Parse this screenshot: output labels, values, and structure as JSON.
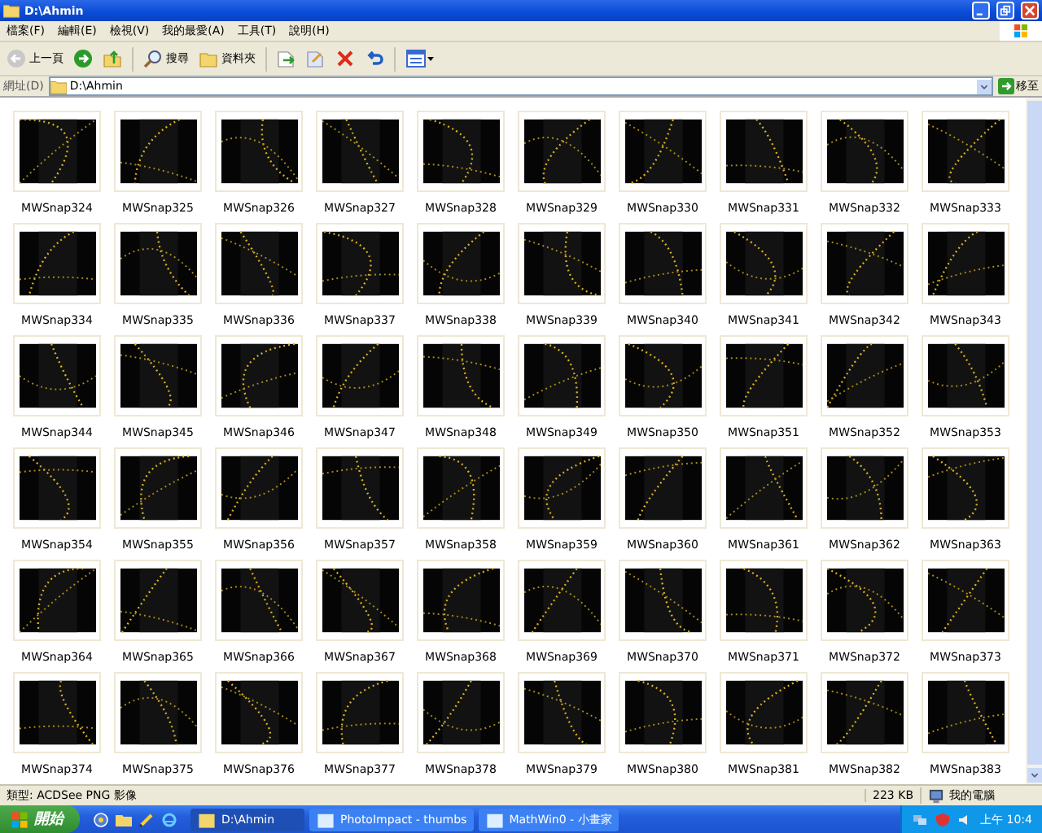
{
  "window": {
    "title": "D:\\Ahmin"
  },
  "menu": [
    "檔案(F)",
    "編輯(E)",
    "檢視(V)",
    "我的最愛(A)",
    "工具(T)",
    "說明(H)"
  ],
  "toolbar": {
    "back": "上一頁",
    "search": "搜尋",
    "folders": "資料夾"
  },
  "address": {
    "label": "網址(D)",
    "value": "D:\\Ahmin",
    "go": "移至"
  },
  "files": [
    "MWSnap324",
    "MWSnap325",
    "MWSnap326",
    "MWSnap327",
    "MWSnap328",
    "MWSnap329",
    "MWSnap330",
    "MWSnap331",
    "MWSnap332",
    "MWSnap333",
    "MWSnap334",
    "MWSnap335",
    "MWSnap336",
    "MWSnap337",
    "MWSnap338",
    "MWSnap339",
    "MWSnap340",
    "MWSnap341",
    "MWSnap342",
    "MWSnap343",
    "MWSnap344",
    "MWSnap345",
    "MWSnap346",
    "MWSnap347",
    "MWSnap348",
    "MWSnap349",
    "MWSnap350",
    "MWSnap351",
    "MWSnap352",
    "MWSnap353",
    "MWSnap354",
    "MWSnap355",
    "MWSnap356",
    "MWSnap357",
    "MWSnap358",
    "MWSnap359",
    "MWSnap360",
    "MWSnap361",
    "MWSnap362",
    "MWSnap363",
    "MWSnap364",
    "MWSnap365",
    "MWSnap366",
    "MWSnap367",
    "MWSnap368",
    "MWSnap369",
    "MWSnap370",
    "MWSnap371",
    "MWSnap372",
    "MWSnap373",
    "MWSnap374",
    "MWSnap375",
    "MWSnap376",
    "MWSnap377",
    "MWSnap378",
    "MWSnap379",
    "MWSnap380",
    "MWSnap381",
    "MWSnap382",
    "MWSnap383"
  ],
  "status_bar": {
    "info": "類型: ACDSee PNG 影像",
    "size": "223 KB",
    "zone": "我的電腦"
  },
  "taskbar": {
    "start": "開始",
    "tasks": [
      {
        "label": "D:\\Ahmin",
        "selected": true
      },
      {
        "label": "PhotoImpact - thumbs",
        "selected": false
      },
      {
        "label": "MathWin0 - 小畫家",
        "selected": false
      }
    ],
    "clock": "上午 10:4"
  }
}
